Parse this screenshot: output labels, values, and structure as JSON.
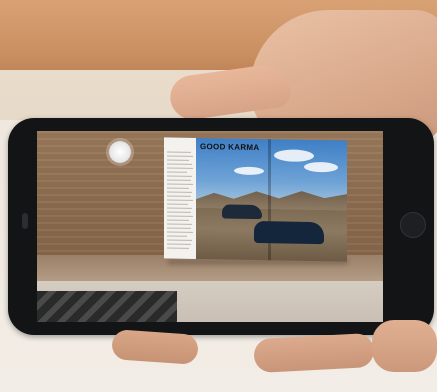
{
  "photo": {
    "description_kind": "photograph",
    "magazine": {
      "headline": "GOOD KARMA"
    },
    "ar_app": {
      "capture_button_icon": "shutter-icon"
    },
    "colors": {
      "sky": "#3f7fc6",
      "table_wood": "#8d6c4f",
      "phone_body": "#121416",
      "skin": "#d9a88a"
    }
  }
}
